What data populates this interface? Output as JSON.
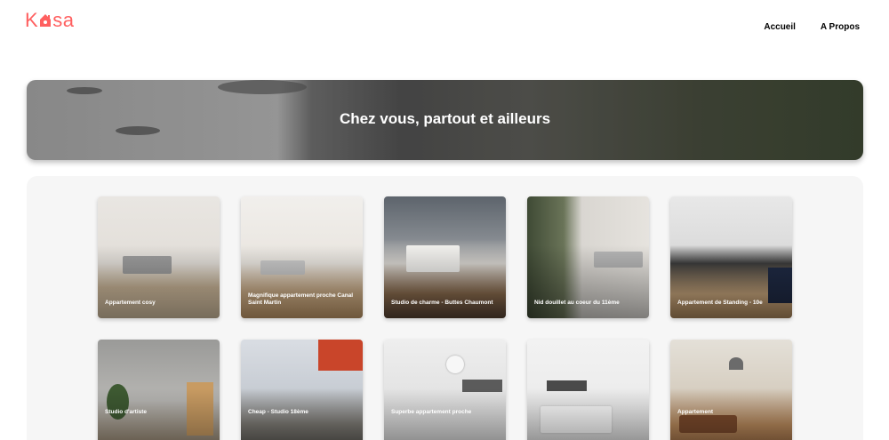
{
  "header": {
    "logo_text_1": "K",
    "logo_text_2": "sa",
    "nav": [
      {
        "label": "Accueil"
      },
      {
        "label": "A Propos"
      }
    ]
  },
  "banner": {
    "title": "Chez vous, partout et ailleurs"
  },
  "listings": [
    {
      "title": "Appartement cosy"
    },
    {
      "title": "Magnifique appartement proche Canal Saint Martin"
    },
    {
      "title": "Studio de charme - Buttes Chaumont"
    },
    {
      "title": "Nid douillet au coeur du 11ème"
    },
    {
      "title": "Appartement de Standing - 10e"
    },
    {
      "title": "Studio d'artiste"
    },
    {
      "title": "Cheap - Studio 18ème"
    },
    {
      "title": "Superbe appartement proche"
    },
    {
      "title": ""
    },
    {
      "title": "Appartement"
    }
  ],
  "colors": {
    "brand": "#ff6060",
    "gallery_bg": "#f6f6f6"
  }
}
